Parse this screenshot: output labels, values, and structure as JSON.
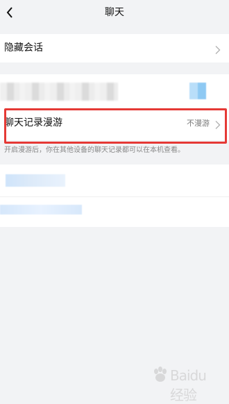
{
  "header": {
    "title": "聊天"
  },
  "hidden_chats": {
    "label": "隐藏会话"
  },
  "chat_history_roaming": {
    "label": "聊天记录漫游",
    "value": "不漫游",
    "hint": "开启漫游后，你在其他设备的聊天记录都可以在本机查看。"
  },
  "colors": {
    "highlight": "#e53935",
    "background": "#f2f3f5",
    "card": "#ffffff"
  },
  "watermark": {
    "text": "Baidu经验"
  }
}
